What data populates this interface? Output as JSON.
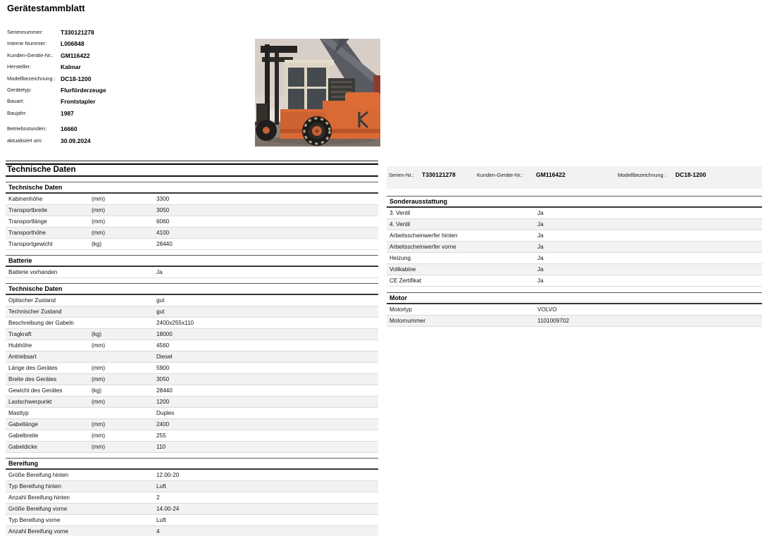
{
  "page": {
    "title": "Gerätestammblatt"
  },
  "colors": {
    "accent_orange": "#d96a35",
    "row_band_gray": "#f2f2f2",
    "row_separator": "#dcdcdc",
    "rule_dark": "#363636"
  },
  "header_fields": [
    {
      "label": "Seriennummer:",
      "value": "T330121278"
    },
    {
      "label": "Interne Nummer:",
      "value": "L006848"
    },
    {
      "label": "Kunden-Geräte-Nr.:",
      "value": "GM116422"
    },
    {
      "label": "Hersteller:",
      "value": "Kalmar"
    },
    {
      "label": "Modellbezeichnung :",
      "value": "DC18-1200"
    },
    {
      "label": "Gerätetyp:",
      "value": "Flurförderzeuge"
    },
    {
      "label": "Bauart:",
      "value": "Frontstapler"
    },
    {
      "label": "Baujahr:",
      "value": "1987"
    },
    {
      "label": "Betriebsstunden:",
      "value": "16660",
      "gap": true
    },
    {
      "label": "aktualisiert am:",
      "value": "30.09.2024"
    }
  ],
  "photo": {
    "description": "Oranger Kalmar Frontstapler auf Schotterplatz mit gelben Baumaschinen im Hintergrund"
  },
  "left_section": {
    "title": "Technische Daten",
    "tables": [
      {
        "heading": "Technische Daten",
        "rows": [
          {
            "label": "Kabinenhöhe",
            "unit": "(mm)",
            "value": "3300"
          },
          {
            "label": "Transportbreite",
            "unit": "(mm)",
            "value": "3050"
          },
          {
            "label": "Transportlänge",
            "unit": "(mm)",
            "value": "6060"
          },
          {
            "label": "Transporthöhe",
            "unit": "(mm)",
            "value": "4100"
          },
          {
            "label": "Transportgewicht",
            "unit": "(kg)",
            "value": "28440"
          }
        ]
      },
      {
        "heading": "Batterie",
        "rows": [
          {
            "label": "Batterie vorhanden",
            "unit": "",
            "value": "Ja"
          }
        ]
      },
      {
        "heading": "Technische Daten",
        "rows": [
          {
            "label": "Optischer Zustand",
            "unit": "",
            "value": "gut"
          },
          {
            "label": "Technischer Zustand",
            "unit": "",
            "value": "gut"
          },
          {
            "label": "Beschreibung der Gabeln",
            "unit": "",
            "value": "2400x255x110"
          },
          {
            "label": "Tragkraft",
            "unit": "(kg)",
            "value": "18000"
          },
          {
            "label": "Hubhöhe",
            "unit": "(mm)",
            "value": "4560"
          },
          {
            "label": "Antriebsart",
            "unit": "",
            "value": "Diesel"
          },
          {
            "label": "Länge des Gerätes",
            "unit": "(mm)",
            "value": "5900"
          },
          {
            "label": "Breite des Gerätes",
            "unit": "(mm)",
            "value": "3050"
          },
          {
            "label": "Gewicht des Gerätes",
            "unit": "(kg)",
            "value": "28440"
          },
          {
            "label": "Lastschwerpunkt",
            "unit": "(mm)",
            "value": "1200"
          },
          {
            "label": "Masttyp",
            "unit": "",
            "value": "Duplex"
          },
          {
            "label": "Gabellänge",
            "unit": "(mm)",
            "value": "2400"
          },
          {
            "label": "Gabelbreite",
            "unit": "(mm)",
            "value": "255"
          },
          {
            "label": "Gabeldicke",
            "unit": "(mm)",
            "value": "110"
          }
        ]
      },
      {
        "heading": "Bereifung",
        "rows": [
          {
            "label": "Größe Bereifung hinten",
            "unit": "",
            "value": "12.00-20"
          },
          {
            "label": "Typ Bereifung hinten",
            "unit": "",
            "value": "Luft"
          },
          {
            "label": "Anzahl Bereifung hinten",
            "unit": "",
            "value": "2"
          },
          {
            "label": "Größe Bereifung vorne",
            "unit": "",
            "value": "14.00-24"
          },
          {
            "label": "Typ Bereifung vorne",
            "unit": "",
            "value": "Luft"
          },
          {
            "label": "Anzahl Bereifung vorne",
            "unit": "",
            "value": "4"
          }
        ]
      }
    ]
  },
  "right_panel": {
    "info_bar": [
      {
        "label": "Serien-Nr.:",
        "value": "T330121278"
      },
      {
        "label": "Kunden-Geräte-Nr.:",
        "value": "GM116422"
      },
      {
        "label": "Modellbezeichnung :",
        "value": "DC18-1200"
      }
    ],
    "tables": [
      {
        "heading": "Sonderausstattung",
        "rows": [
          {
            "label": "3. Ventil",
            "unit": "",
            "value": "Ja"
          },
          {
            "label": "4. Ventil",
            "unit": "",
            "value": "Ja"
          },
          {
            "label": "Arbeitsscheinwerfer hinten",
            "unit": "",
            "value": "Ja"
          },
          {
            "label": "Arbeitsscheinwerfer vorne",
            "unit": "",
            "value": "Ja"
          },
          {
            "label": "Heizung",
            "unit": "",
            "value": "Ja"
          },
          {
            "label": "Vollkabine",
            "unit": "",
            "value": "Ja"
          },
          {
            "label": "CE Zertifikat",
            "unit": "",
            "value": "Ja"
          }
        ]
      },
      {
        "heading": "Motor",
        "rows": [
          {
            "label": "Motortyp",
            "unit": "",
            "value": "VOLVO"
          },
          {
            "label": "Motornummer",
            "unit": "",
            "value": "1101009702"
          }
        ]
      }
    ]
  }
}
